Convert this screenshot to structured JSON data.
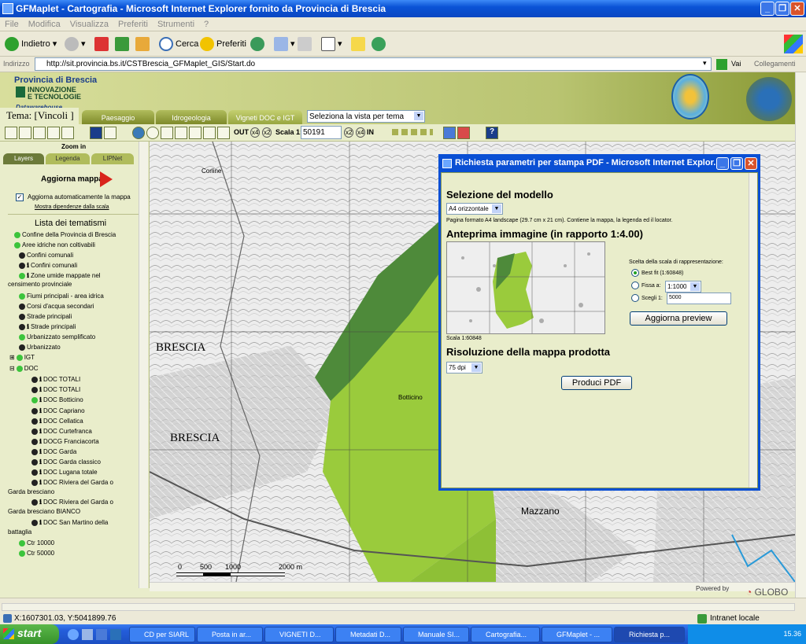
{
  "window": {
    "title": "GFMaplet - Cartografia - Microsoft Internet Explorer fornito da Provincia di Brescia"
  },
  "menu": [
    "File",
    "Modifica",
    "Visualizza",
    "Preferiti",
    "Strumenti",
    "?"
  ],
  "toolbar": {
    "back": "Indietro",
    "search": "Cerca",
    "favorites": "Preferiti"
  },
  "address": {
    "label": "Indirizzo",
    "url": "http://sit.provincia.bs.it/CSTBrescia_GFMaplet_GIS/Start.do",
    "go": "Vai",
    "links": "Collegamenti"
  },
  "header": {
    "province": "Provincia di Brescia",
    "innovation_line1": "INNOVAZIONE",
    "innovation_line2": "E TECNOLOGIE",
    "datawarehouse": "Datawarehouse Geografico"
  },
  "tema": {
    "label": "Tema: [Vincoli ]",
    "tabs": [
      "Paesaggio",
      "Idrogeologia",
      "Vigneti DOC e IGT"
    ],
    "view_select": "Seleziona la vista per tema"
  },
  "maptoolbar": {
    "out": "OUT",
    "x4": "x4",
    "x2": "x2",
    "scale_label": "Scala 1:",
    "scale_value": "50191",
    "in": "IN"
  },
  "sidebar": {
    "zoom_in": "Zoom in",
    "tabs": [
      "Layers",
      "Legenda",
      "LIPNet"
    ],
    "refresh": "Aggiorna mappa",
    "auto_refresh": "Aggiorna automaticamente la mappa",
    "show_scale_dep": "Mostra dipendenze dalla scala",
    "themes_title": "Lista dei tematismi",
    "layers": [
      "Confine della Provincia di Brescia",
      "Aree idriche non coltivabili",
      "Confini comunali",
      "Confini comunali",
      "Zone umide mappate nel",
      "censimento provinciale",
      "Fiumi principali - area idrica",
      "Corsi d'acqua secondari",
      "Strade principali",
      "Strade principali",
      "Urbanizzato semplificato",
      "Urbanizzato",
      "IGT",
      "DOC",
      "DOC TOTALI",
      "DOC TOTALI",
      "DOC Botticino",
      "DOC Capriano",
      "DOC Cellatica",
      "DOC Curtefranca",
      "DOCG Franciacorta",
      "DOC Garda",
      "DOC Garda classico",
      "DOC Lugana totale",
      "DOC Riviera del Garda o",
      "Garda bresciano",
      "DOC Riviera del Garda o",
      "Garda bresciano BIANCO",
      "DOC San Martino della",
      "battaglia",
      "Ctr 10000",
      "Ctr 50000"
    ]
  },
  "map": {
    "labels": [
      "BRESCIA",
      "BRESCIA",
      "Mazzano",
      "Corline",
      "Botticino"
    ],
    "scalebar": [
      "0",
      "500",
      "1000",
      "2000 m"
    ],
    "powered": "Powered by",
    "brand": "GLOBO"
  },
  "dialog": {
    "title": "Richiesta parametri per stampa PDF - Microsoft Internet Explor...",
    "sel_model": "Selezione del modello",
    "model_value": "A4 orizzontale",
    "model_desc": "Pagina formato A4 landscape (29.7 cm x 21 cm). Contiene la mappa, la legenda ed il locator.",
    "preview_title": "Anteprima immagine (in rapporto 1:4.00)",
    "scale_caption": "Scala 1:60848",
    "scale_choice_title": "Scelta della scala di rappresentazione:",
    "best_fit": "Best fit (1:60848)",
    "fixed": "Fissa a:",
    "fixed_value": "1:1000",
    "choose": "Scegli 1:",
    "choose_value": "5000",
    "update_preview": "Aggiorna preview",
    "resolution_title": "Risoluzione della mappa prodotta",
    "dpi_value": "75 dpi",
    "produce_pdf": "Produci PDF"
  },
  "status": {
    "coords": "X:1607301.03, Y:5041899.76",
    "zone": "Intranet locale"
  },
  "taskbar": {
    "start": "start",
    "tasks": [
      "CD per SIARL",
      "Posta in ar...",
      "VIGNETI D...",
      "Metadati D...",
      "Manuale SI...",
      "Cartografia...",
      "GFMaplet - ...",
      "Richiesta p..."
    ],
    "clock": "15.36"
  },
  "colors": {
    "doc_green": "#9acb3c",
    "doc_dark": "#4e8a3a",
    "xp_blue": "#0a4fd4"
  }
}
